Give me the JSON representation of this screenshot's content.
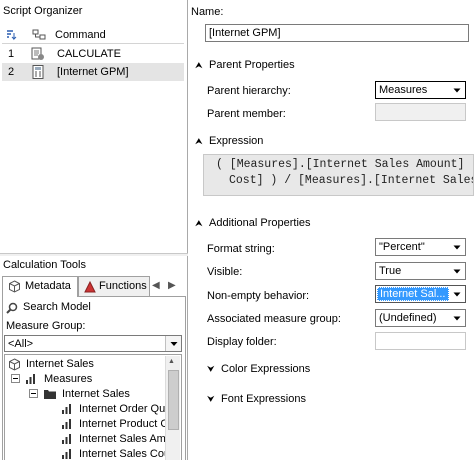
{
  "script_organizer": {
    "title": "Script Organizer",
    "column_command": "Command",
    "rows": [
      {
        "num": "1",
        "text": "CALCULATE",
        "icon": "script-command-icon"
      },
      {
        "num": "2",
        "text": "[Internet GPM]",
        "icon": "calculated-member-icon"
      }
    ]
  },
  "calc_tools": {
    "title": "Calculation Tools",
    "tabs": [
      "Metadata",
      "Functions"
    ],
    "search_model": "Search Model",
    "measure_group_label": "Measure Group:",
    "measure_group_value": "<All>",
    "tree": [
      {
        "text": "Internet Sales",
        "icon": "cube-icon",
        "level": 0
      },
      {
        "text": "Measures",
        "icon": "measures-icon",
        "level": 1
      },
      {
        "text": "Internet Sales",
        "icon": "folder-icon",
        "level": 2
      },
      {
        "text": "Internet Order Qua",
        "icon": "measure-icon",
        "level": 3
      },
      {
        "text": "Internet Product Co",
        "icon": "measure-icon",
        "level": 3
      },
      {
        "text": "Internet Sales Amo",
        "icon": "measure-icon",
        "level": 3
      },
      {
        "text": "Internet Sales Cou",
        "icon": "measure-icon",
        "level": 3
      }
    ]
  },
  "form": {
    "name_label": "Name:",
    "name_value": "[Internet GPM]",
    "parent_properties": "Parent Properties",
    "parent_hierarchy_label": "Parent hierarchy:",
    "parent_hierarchy_value": "Measures",
    "parent_member_label": "Parent member:",
    "expression_label": "Expression",
    "expression_line1": "( [Measures].[Internet Sales Amount] -",
    "expression_line2": "Cost] ) / [Measures].[Internet Sales A",
    "additional_properties": "Additional Properties",
    "format_string_label": "Format string:",
    "format_string_value": "\"Percent\"",
    "visible_label": "Visible:",
    "visible_value": "True",
    "non_empty_label": "Non-empty behavior:",
    "non_empty_value": "Internet Sal...",
    "assoc_mg_label": "Associated measure group:",
    "assoc_mg_value": "(Undefined)",
    "display_folder_label": "Display folder:",
    "color_expressions": "Color Expressions",
    "font_expressions": "Font Expressions"
  }
}
